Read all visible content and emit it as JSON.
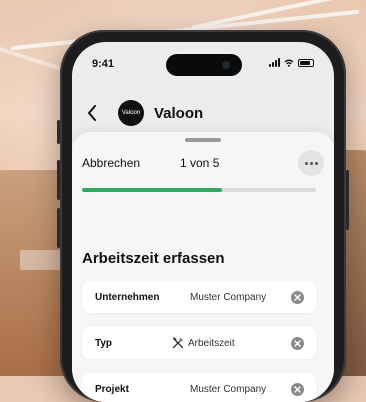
{
  "status_bar": {
    "time": "9:41"
  },
  "navbar": {
    "avatar_text": "Valoon",
    "title": "Valoon"
  },
  "sheet": {
    "cancel_label": "Abbrechen",
    "step_label": "1 von 5",
    "progress_fraction": 0.6,
    "progress_color": "#2eaa5c"
  },
  "form": {
    "title": "Arbeitszeit erfassen",
    "fields": [
      {
        "label": "Unternehmen",
        "value": "Muster Company"
      },
      {
        "label": "Typ",
        "value": "Arbeitszeit",
        "value_icon": "tools-icon"
      },
      {
        "label": "Projekt",
        "value": "Muster Company"
      }
    ]
  }
}
